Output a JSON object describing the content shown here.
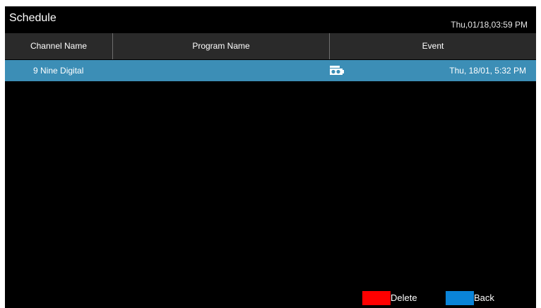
{
  "header": {
    "title": "Schedule",
    "datetime": "Thu,01/18,03:59 PM"
  },
  "table": {
    "columns": [
      "Channel Name",
      "Program Name",
      "Event"
    ],
    "rows": [
      {
        "channel": "9  Nine Digital",
        "program": "",
        "event_icon": "record-icon",
        "event_time": "Thu, 18/01, 5:32 PM"
      }
    ]
  },
  "footer": {
    "buttons": [
      {
        "label": "Delete",
        "color": "#ff0000"
      },
      {
        "label": "Back",
        "color": "#0a84d8"
      }
    ]
  },
  "colors": {
    "background": "#000000",
    "header_row": "#2a2a2a",
    "selected_row": "#3c8eb6"
  }
}
